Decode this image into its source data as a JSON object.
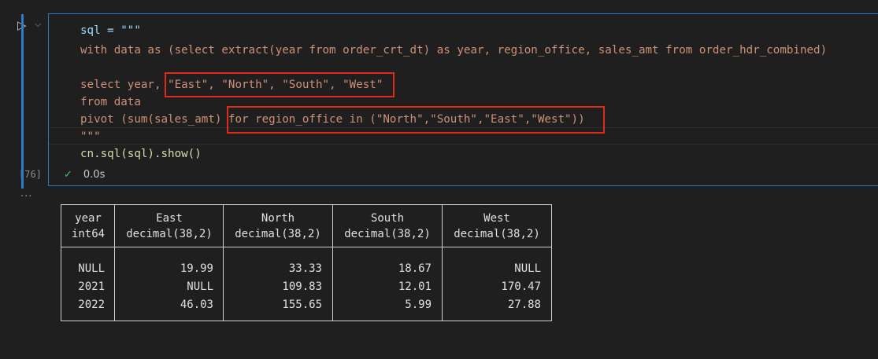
{
  "cell": {
    "exec_count": "[76]",
    "status_time": "0.0s",
    "code_lines": [
      "sql = \"\"\"",
      "with data as (select extract(year from order_crt_dt) as year, region_office, sales_amt from order_hdr_combined)",
      "",
      "select year, \"East\", \"North\", \"South\", \"West\"",
      "from data",
      "pivot (sum(sales_amt) for region_office in (\"North\",\"South\",\"East\",\"West\"))",
      "\"\"\"",
      "cn.sql(sql).show()"
    ]
  },
  "output": {
    "more_icon": "ellipsis-icon",
    "headers": [
      {
        "name": "year",
        "type": "int64"
      },
      {
        "name": "East",
        "type": "decimal(38,2)"
      },
      {
        "name": "North",
        "type": "decimal(38,2)"
      },
      {
        "name": "South",
        "type": "decimal(38,2)"
      },
      {
        "name": "West",
        "type": "decimal(38,2)"
      }
    ],
    "rows": [
      [
        "NULL",
        "19.99",
        "33.33",
        "18.67",
        "NULL"
      ],
      [
        "2021",
        "NULL",
        "109.83",
        "12.01",
        "170.47"
      ],
      [
        "2022",
        "46.03",
        "155.65",
        "5.99",
        "27.88"
      ]
    ]
  },
  "colors": {
    "highlight_box": "#e02a1a",
    "focus_border": "#2b78c8",
    "success_check": "#4ec275"
  }
}
